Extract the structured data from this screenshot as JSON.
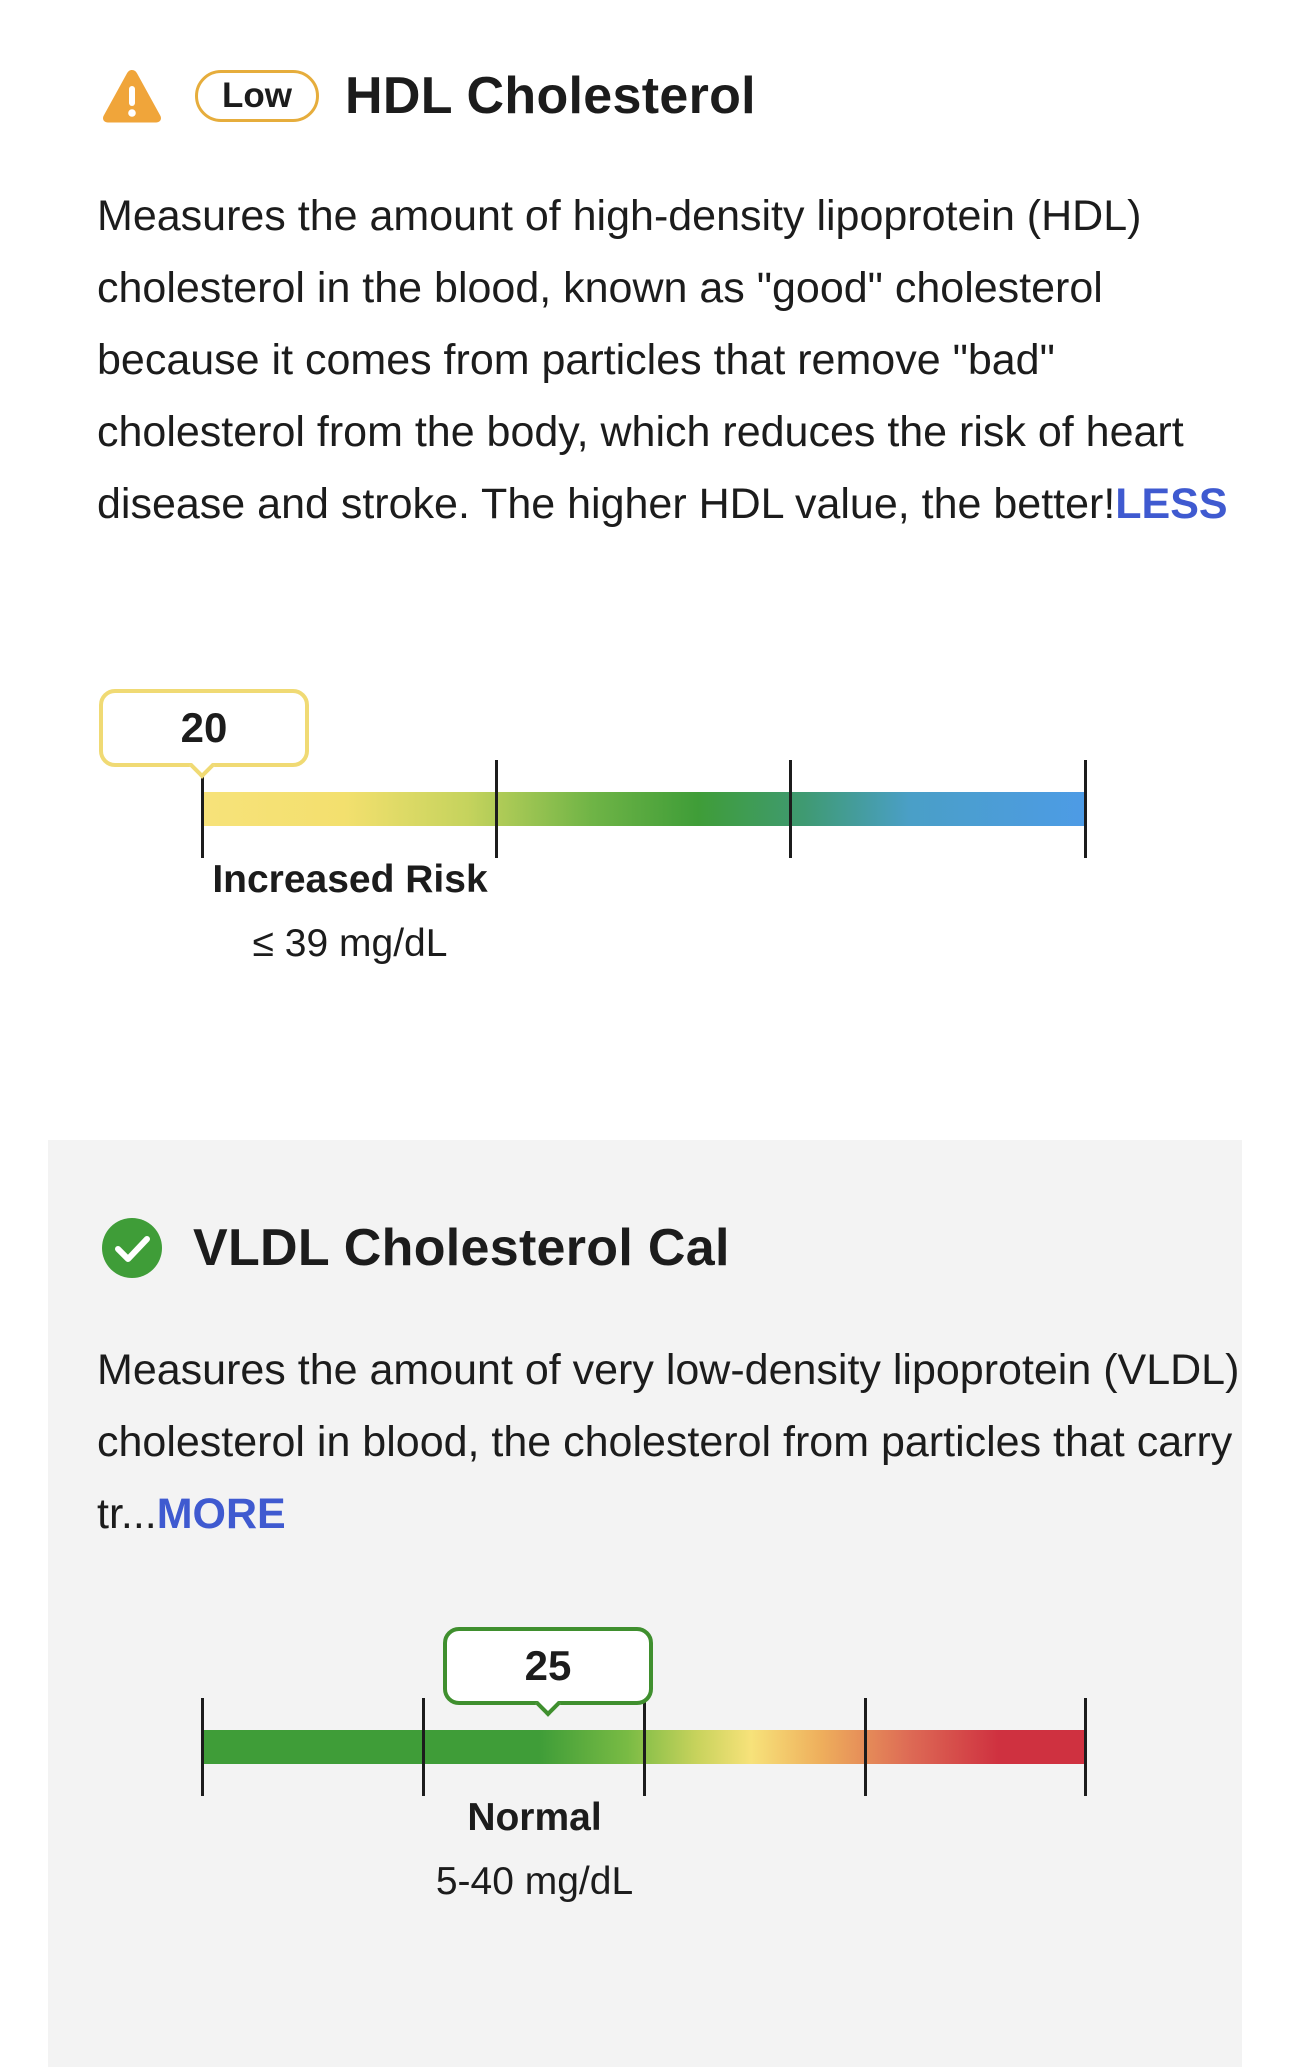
{
  "hdl": {
    "status_badge": "Low",
    "title": "HDL Cholesterol",
    "description": "Measures the amount of high-density lipoprotein (HDL) cholesterol in the blood, known as \"good\" cholesterol because it comes from particles that remove \"bad\" cholesterol from the body, which reduces the risk of heart disease and stroke. The higher HDL value, the better!",
    "toggle_label": "LESS",
    "result_value": "20",
    "range_label": "Increased Risk",
    "range_value": "≤ 39 mg/dL",
    "icon": "warning-icon",
    "status_color": "#e6a23c"
  },
  "vldl": {
    "title": "VLDL Cholesterol Cal",
    "description": "Measures the amount of very low-density lipoprotein (VLDL) cholesterol in blood, the cholesterol from particles that carry tr...",
    "toggle_label": "MORE",
    "result_value": "25",
    "range_label": "Normal",
    "range_value": "5-40 mg/dL",
    "icon": "check-circle-icon",
    "status_color": "#3f9d38"
  },
  "colors": {
    "link": "#3f5ad0",
    "card_background": "#f3f3f3"
  }
}
